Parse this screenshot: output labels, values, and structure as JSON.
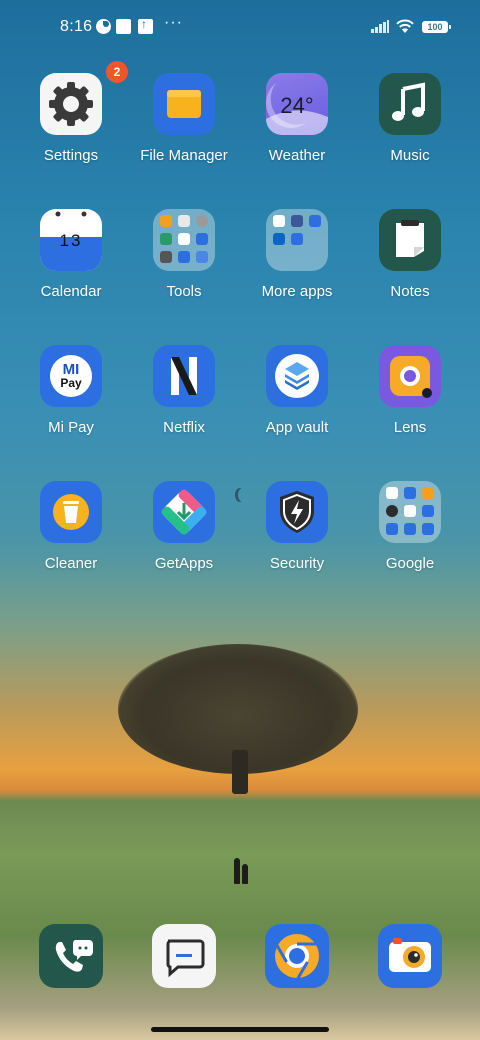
{
  "status_bar": {
    "time": "8:16",
    "more": "···",
    "battery": "100",
    "icons": [
      "notification-icon",
      "square-notification-icon",
      "upload-notification-icon",
      "signal-icon",
      "wifi-icon",
      "battery-icon"
    ]
  },
  "apps": [
    {
      "label": "Settings",
      "icon": "gear-icon",
      "badge": "2"
    },
    {
      "label": "File Manager",
      "icon": "folder-icon"
    },
    {
      "label": "Weather",
      "icon": "weather-icon",
      "temp": "24°"
    },
    {
      "label": "Music",
      "icon": "music-note-icon"
    },
    {
      "label": "Calendar",
      "icon": "calendar-icon",
      "day": "13"
    },
    {
      "label": "Tools",
      "icon": "folder-tools-icon"
    },
    {
      "label": "More apps",
      "icon": "folder-more-apps-icon"
    },
    {
      "label": "Notes",
      "icon": "notes-icon"
    },
    {
      "label": "Mi Pay",
      "icon": "mi-pay-icon",
      "mi": "MI",
      "pay": "Pay"
    },
    {
      "label": "Netflix",
      "icon": "netflix-icon"
    },
    {
      "label": "App vault",
      "icon": "app-vault-icon"
    },
    {
      "label": "Lens",
      "icon": "lens-icon"
    },
    {
      "label": "Cleaner",
      "icon": "cleaner-icon"
    },
    {
      "label": "GetApps",
      "icon": "getapps-icon"
    },
    {
      "label": "Security",
      "icon": "security-shield-icon"
    },
    {
      "label": "Google",
      "icon": "folder-google-icon"
    }
  ],
  "dock": [
    {
      "name": "phone",
      "icon": "phone-icon"
    },
    {
      "name": "messages",
      "icon": "messages-icon"
    },
    {
      "name": "chrome",
      "icon": "chrome-icon"
    },
    {
      "name": "camera",
      "icon": "camera-icon"
    }
  ],
  "colors": {
    "accent_blue": "#2d6fe0",
    "dark_green": "#24574b",
    "badge_red": "#f2552c"
  }
}
